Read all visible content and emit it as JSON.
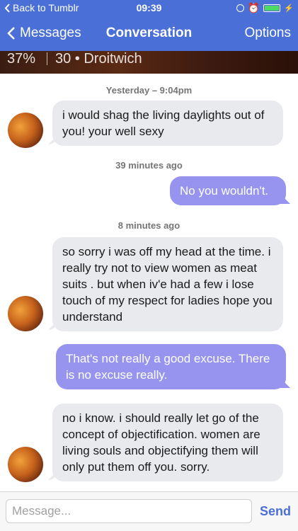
{
  "status_bar": {
    "back_label": "Back to Tumblr",
    "time": "09:39",
    "battery_percent": 100
  },
  "nav": {
    "back_label": "Messages",
    "title": "Conversation",
    "options_label": "Options"
  },
  "profile": {
    "match_percent": "37%",
    "age_location": "30 • Droitwich"
  },
  "timestamps": [
    "Yesterday – 9:04pm",
    "39 minutes ago",
    "8 minutes ago"
  ],
  "messages": [
    {
      "direction": "incoming",
      "text": "i would shag the living daylights out of you! your well sexy"
    },
    {
      "direction": "outgoing",
      "text": "No you wouldn't."
    },
    {
      "direction": "incoming",
      "text": "so sorry i was off my head at the time. i really try not to view women as meat suits . but when iv'e had a few i lose touch of my respect for ladies hope you understand"
    },
    {
      "direction": "outgoing",
      "text": "That's not really a good excuse. There is no excuse really."
    },
    {
      "direction": "incoming",
      "text": "no i know. i should really let go of the concept of objectification. women are living souls and objectifying them will only put them off you. sorry."
    }
  ],
  "composer": {
    "placeholder": "Message...",
    "value": "",
    "send_label": "Send"
  },
  "colors": {
    "nav_bar": "#4a6fd6",
    "incoming_bubble": "#e9eaee",
    "outgoing_bubble": "#9694ee",
    "send_text": "#4a6fd6"
  }
}
